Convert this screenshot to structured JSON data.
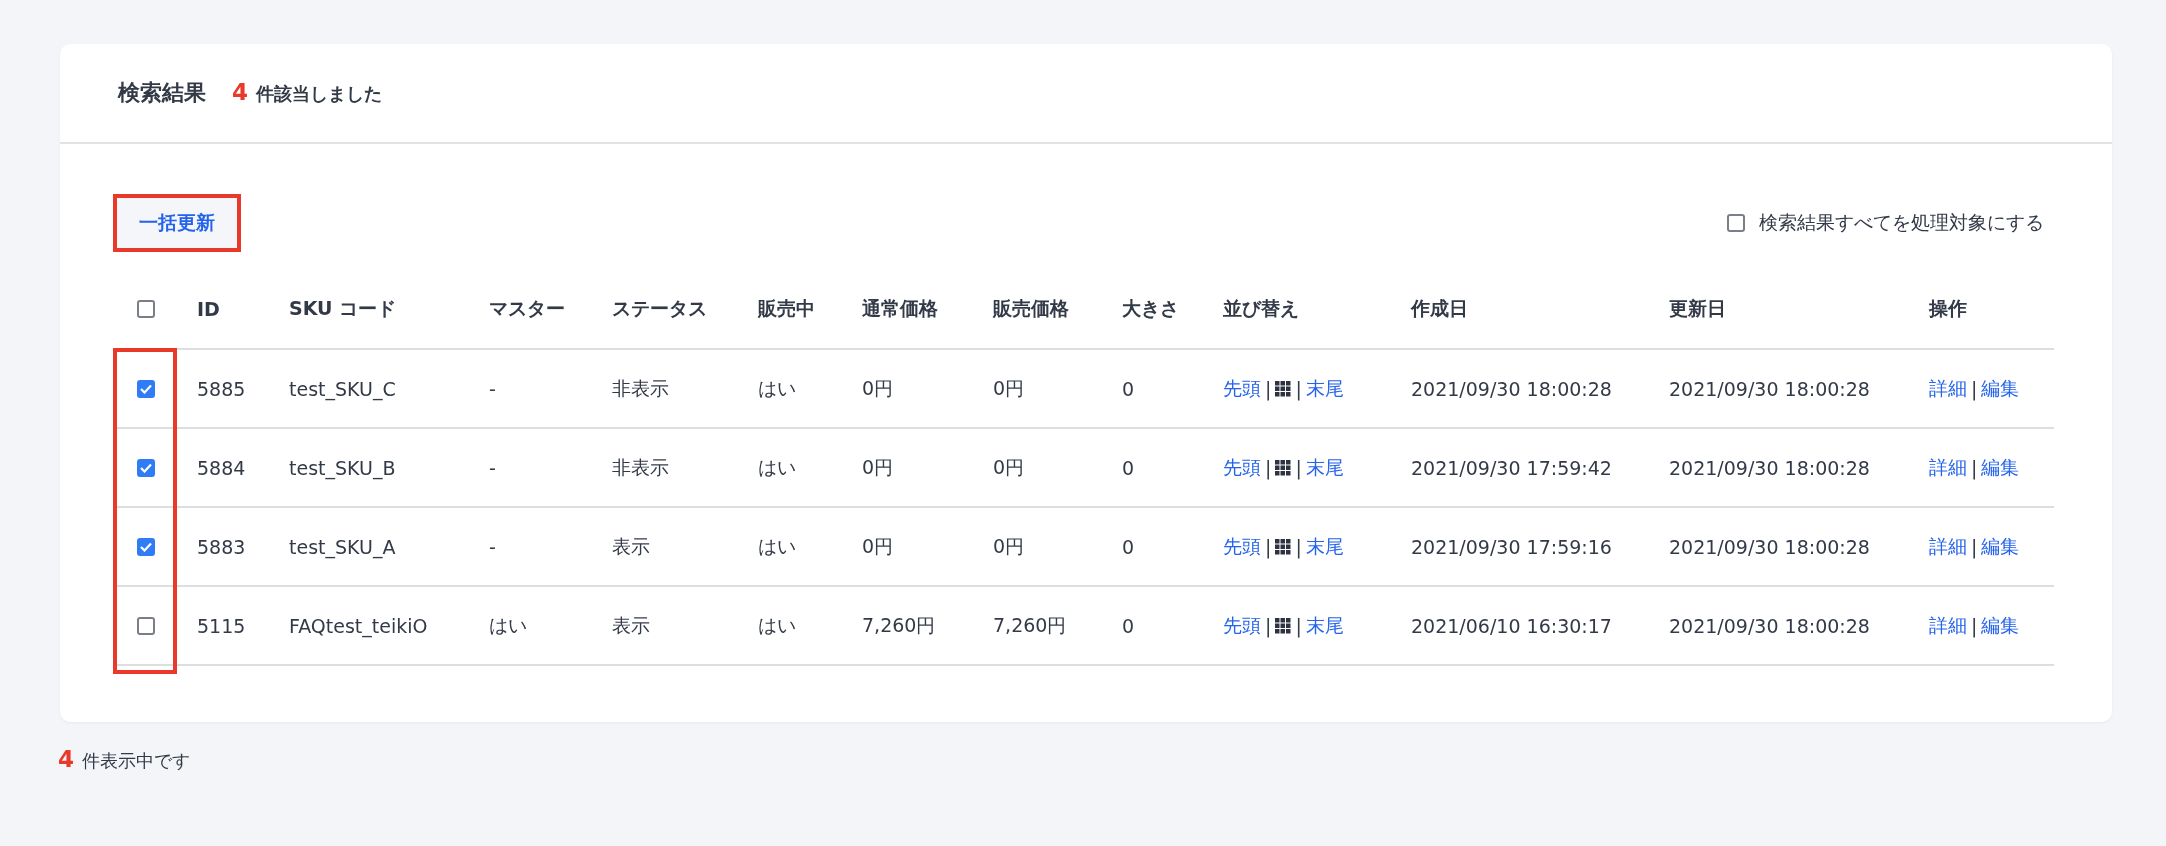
{
  "header": {
    "title": "検索結果",
    "count": "4",
    "count_suffix": "件該当しました"
  },
  "toolbar": {
    "bulk_button": {
      "label": "一括更新",
      "highlighted": true
    },
    "select_all": {
      "label": "検索結果すべてを処理対象にする",
      "checked": false
    }
  },
  "table": {
    "header_checkbox": {
      "checked": false
    },
    "checkbox_column_highlighted": true,
    "columns": [
      "ID",
      "SKU コード",
      "マスター",
      "ステータス",
      "販売中",
      "通常価格",
      "販売価格",
      "大きさ",
      "並び替え",
      "作成日",
      "更新日",
      "操作"
    ],
    "rows": [
      {
        "checked": true,
        "id": "5885",
        "sku": "test_SKU_C",
        "master": "-",
        "status": "非表示",
        "on_sale": "はい",
        "regular_price": "0円",
        "sale_price": "0円",
        "size": "0",
        "sort": {
          "top": "先頭",
          "sep": "|",
          "sep_2": "|",
          "bottom": "末尾"
        },
        "created": "2021/09/30 18:00:28",
        "updated": "2021/09/30 18:00:28",
        "actions": {
          "detail": "詳細",
          "sep": "|",
          "edit": "編集"
        }
      },
      {
        "checked": true,
        "id": "5884",
        "sku": "test_SKU_B",
        "master": "-",
        "status": "非表示",
        "on_sale": "はい",
        "regular_price": "0円",
        "sale_price": "0円",
        "size": "0",
        "sort": {
          "top": "先頭",
          "sep": "|",
          "sep_2": "|",
          "bottom": "末尾"
        },
        "created": "2021/09/30 17:59:42",
        "updated": "2021/09/30 18:00:28",
        "actions": {
          "detail": "詳細",
          "sep": "|",
          "edit": "編集"
        }
      },
      {
        "checked": true,
        "id": "5883",
        "sku": "test_SKU_A",
        "master": "-",
        "status": "表示",
        "on_sale": "はい",
        "regular_price": "0円",
        "sale_price": "0円",
        "size": "0",
        "sort": {
          "top": "先頭",
          "sep": "|",
          "sep_2": "|",
          "bottom": "末尾"
        },
        "created": "2021/09/30 17:59:16",
        "updated": "2021/09/30 18:00:28",
        "actions": {
          "detail": "詳細",
          "sep": "|",
          "edit": "編集"
        }
      },
      {
        "checked": false,
        "id": "5115",
        "sku": "FAQtest_teikiO",
        "master": "はい",
        "status": "表示",
        "on_sale": "はい",
        "regular_price": "7,260円",
        "sale_price": "7,260円",
        "size": "0",
        "sort": {
          "top": "先頭",
          "sep": "|",
          "sep_2": "|",
          "bottom": "末尾"
        },
        "created": "2021/06/10 16:30:17",
        "updated": "2021/09/30 18:00:28",
        "actions": {
          "detail": "詳細",
          "sep": "|",
          "edit": "編集"
        }
      }
    ]
  },
  "footer": {
    "count": "4",
    "count_suffix": "件表示中です"
  }
}
